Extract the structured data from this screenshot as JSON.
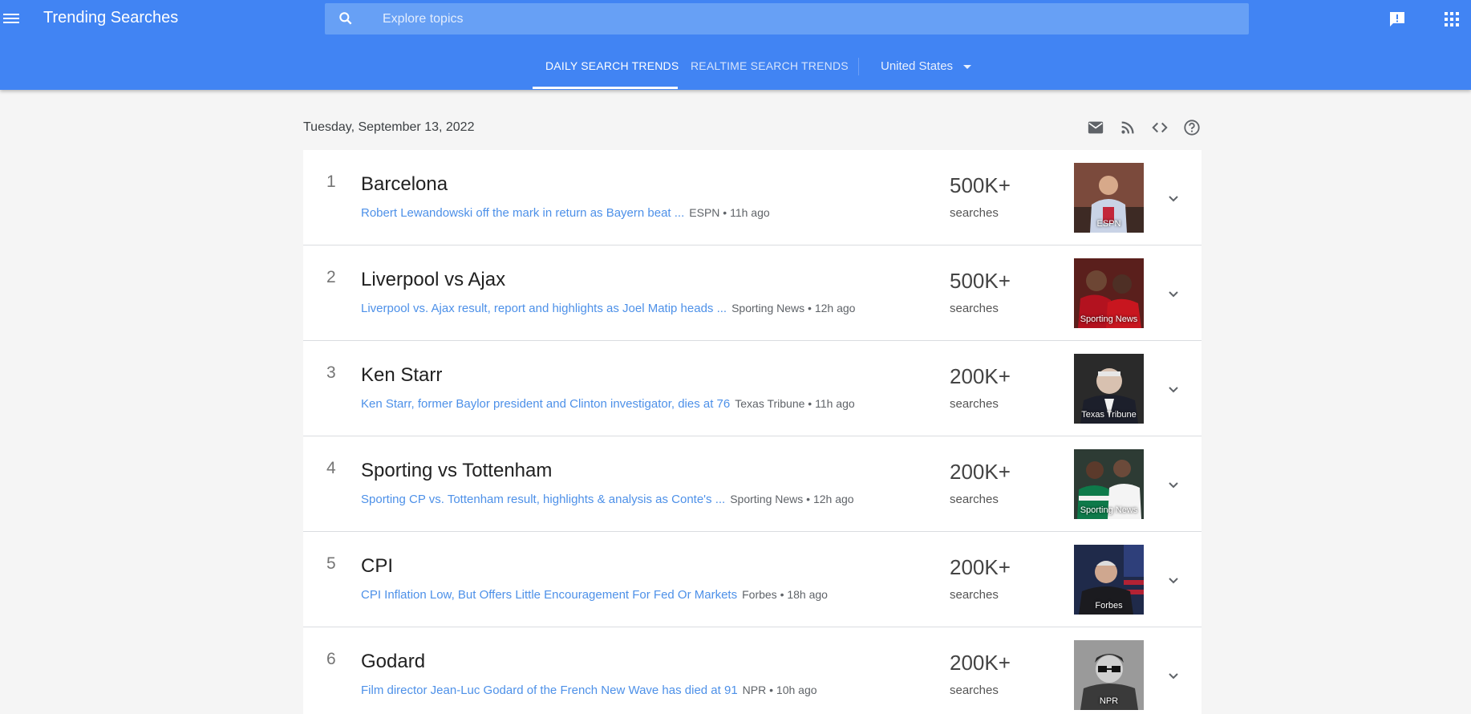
{
  "header": {
    "title": "Trending Searches",
    "search_placeholder": "Explore topics",
    "icons": [
      "menu-icon",
      "search-icon",
      "feedback-icon",
      "apps-grid-icon"
    ]
  },
  "tabs": {
    "daily": "DAILY SEARCH TRENDS",
    "realtime": "REALTIME SEARCH TRENDS",
    "geo": "United States"
  },
  "date": "Tuesday, September 13, 2022",
  "utility_icons": [
    "mail-icon",
    "rss-icon",
    "embed-code-icon",
    "help-icon"
  ],
  "colors": {
    "brand": "#4184f3",
    "link": "#1a73e8",
    "background": "#f5f5f5"
  },
  "trends": [
    {
      "rank": "1",
      "title": "Barcelona",
      "article": "Robert Lewandowski off the mark in return as Bayern beat ...",
      "source": "ESPN • 11h ago",
      "count": "500K+",
      "count_label": "searches",
      "image_caption": "ESPN"
    },
    {
      "rank": "2",
      "title": "Liverpool vs Ajax",
      "article": "Liverpool vs. Ajax result, report and highlights as Joel Matip heads ...",
      "source": "Sporting News • 12h ago",
      "count": "500K+",
      "count_label": "searches",
      "image_caption": "Sporting News"
    },
    {
      "rank": "3",
      "title": "Ken Starr",
      "article": "Ken Starr, former Baylor president and Clinton investigator, dies at 76",
      "source": "Texas Tribune • 11h ago",
      "count": "200K+",
      "count_label": "searches",
      "image_caption": "Texas Tribune"
    },
    {
      "rank": "4",
      "title": "Sporting vs Tottenham",
      "article": "Sporting CP vs. Tottenham result, highlights & analysis as Conte's ...",
      "source": "Sporting News • 12h ago",
      "count": "200K+",
      "count_label": "searches",
      "image_caption": "Sporting News"
    },
    {
      "rank": "5",
      "title": "CPI",
      "article": "CPI Inflation Low, But Offers Little Encouragement For Fed Or Markets",
      "source": "Forbes • 18h ago",
      "count": "200K+",
      "count_label": "searches",
      "image_caption": "Forbes"
    },
    {
      "rank": "6",
      "title": "Godard",
      "article": "Film director Jean-Luc Godard of the French New Wave has died at 91",
      "source": "NPR • 10h ago",
      "count": "200K+",
      "count_label": "searches",
      "image_caption": "NPR"
    }
  ]
}
